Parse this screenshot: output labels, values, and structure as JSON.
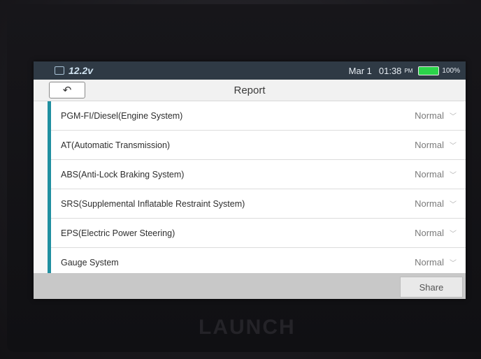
{
  "status": {
    "voltage": "12.2v",
    "date": "Mar 1",
    "time": "01:38",
    "ampm": "PM",
    "battery": "100%"
  },
  "header": {
    "title": "Report",
    "back_icon": "↶"
  },
  "systems": [
    {
      "name": "PGM-FI/Diesel(Engine System)",
      "status": "Normal"
    },
    {
      "name": "AT(Automatic Transmission)",
      "status": "Normal"
    },
    {
      "name": "ABS(Anti-Lock Braking System)",
      "status": "Normal"
    },
    {
      "name": "SRS(Supplemental Inflatable Restraint System)",
      "status": "Normal"
    },
    {
      "name": "EPS(Electric Power Steering)",
      "status": "Normal"
    },
    {
      "name": "Gauge System",
      "status": "Normal"
    }
  ],
  "footer": {
    "share_label": "Share"
  },
  "device": {
    "brand": "LAUNCH"
  }
}
